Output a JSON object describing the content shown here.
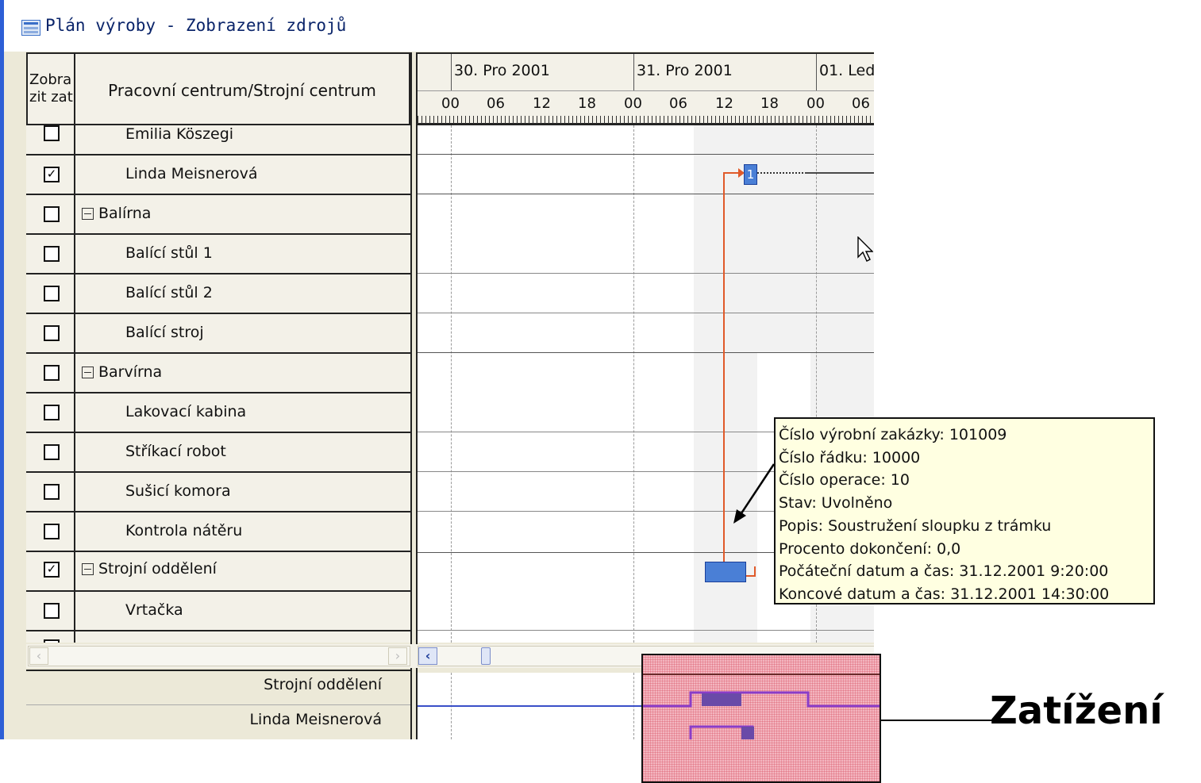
{
  "window": {
    "title": "Plán výroby - Zobrazení zdrojů"
  },
  "grid_header": {
    "show_col": "Zobra zit zat",
    "name_col": "Pracovní centrum/Strojní centrum"
  },
  "timeline": {
    "days": [
      "30. Pro 2001",
      "31. Pro 2001",
      "01. Led"
    ],
    "hours": [
      "00",
      "06",
      "12",
      "18",
      "00",
      "06",
      "12",
      "18",
      "00",
      "06"
    ]
  },
  "rows": [
    {
      "label": "Emilia Köszegi",
      "checked": false,
      "level": 2
    },
    {
      "label": "Linda Meisnerová",
      "checked": true,
      "level": 2
    },
    {
      "label": "Balírna",
      "checked": false,
      "level": 1
    },
    {
      "label": "Balící stůl 1",
      "checked": false,
      "level": 2
    },
    {
      "label": "Balící stůl 2",
      "checked": false,
      "level": 2
    },
    {
      "label": "Balící stroj",
      "checked": false,
      "level": 2
    },
    {
      "label": "Barvírna",
      "checked": false,
      "level": 1
    },
    {
      "label": "Lakovací kabina",
      "checked": false,
      "level": 2
    },
    {
      "label": "Stříkací robot",
      "checked": false,
      "level": 2
    },
    {
      "label": "Sušicí komora",
      "checked": false,
      "level": 2
    },
    {
      "label": "Kontrola nátěru",
      "checked": false,
      "level": 2
    },
    {
      "label": "Strojní oddělení",
      "checked": true,
      "level": 1
    },
    {
      "label": "Vrtačka",
      "checked": false,
      "level": 2
    }
  ],
  "load_panel": {
    "labels": [
      "Strojní oddělení",
      "Linda Meisnerová"
    ]
  },
  "gantt": {
    "task_label": "1"
  },
  "tooltip": {
    "lines": [
      "Číslo výrobní zakázky: 101009",
      "Číslo řádku: 10000",
      "Číslo operace: 10",
      "Stav: Uvolněno",
      "Popis: Soustružení sloupku z trámku",
      "Procento dokončení: 0,0",
      "Počáteční datum a čas: 31.12.2001 9:20:00",
      "Koncové datum a čas: 31.12.2001 14:30:00"
    ]
  },
  "annotation": {
    "label": "Zatížení"
  },
  "colors": {
    "titlebar_text": "#0a246a",
    "task_bar": "#4a7fd6",
    "link_line": "#e05a2a",
    "load_line": "#7a3cc8",
    "tooltip_bg": "#ffffe1",
    "callout_bg": "#f3b6c0"
  }
}
